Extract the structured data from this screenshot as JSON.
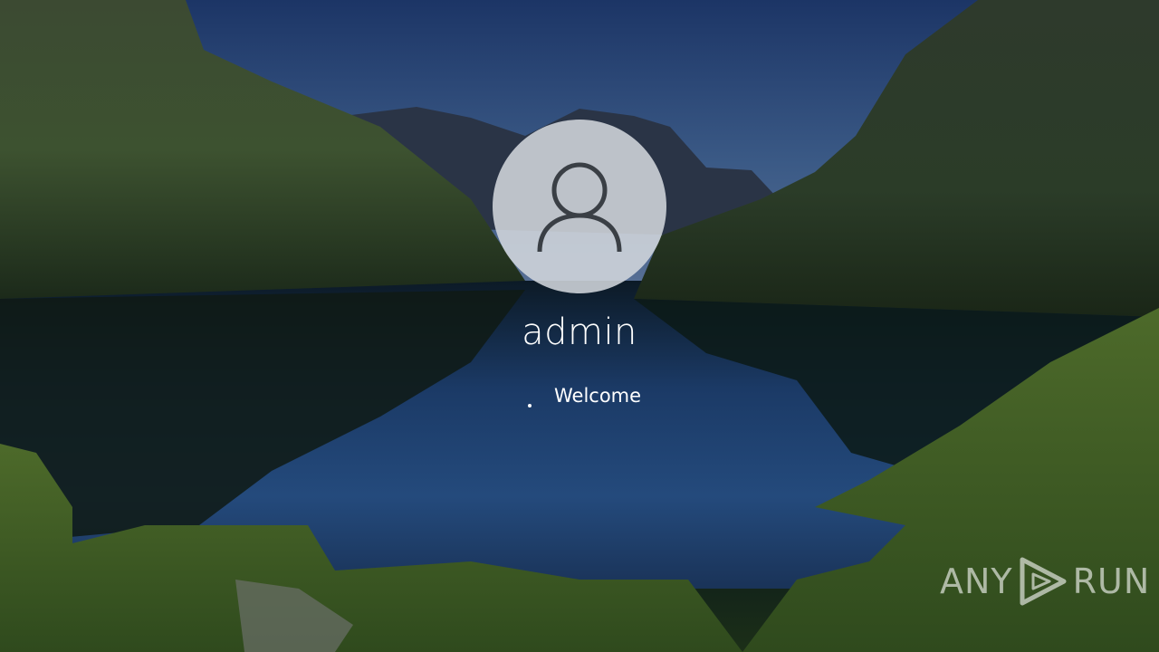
{
  "user": {
    "name": "admin",
    "avatar_icon": "user-icon"
  },
  "status": {
    "text": "Welcome",
    "spinner_icon": "loading-spinner-icon"
  },
  "watermark": {
    "left": "ANY",
    "right": "RUN",
    "icon": "play-icon"
  },
  "colors": {
    "text": "#ffffff",
    "avatar_bg": "#d2d6dc",
    "avatar_glyph": "#3a3f45"
  }
}
